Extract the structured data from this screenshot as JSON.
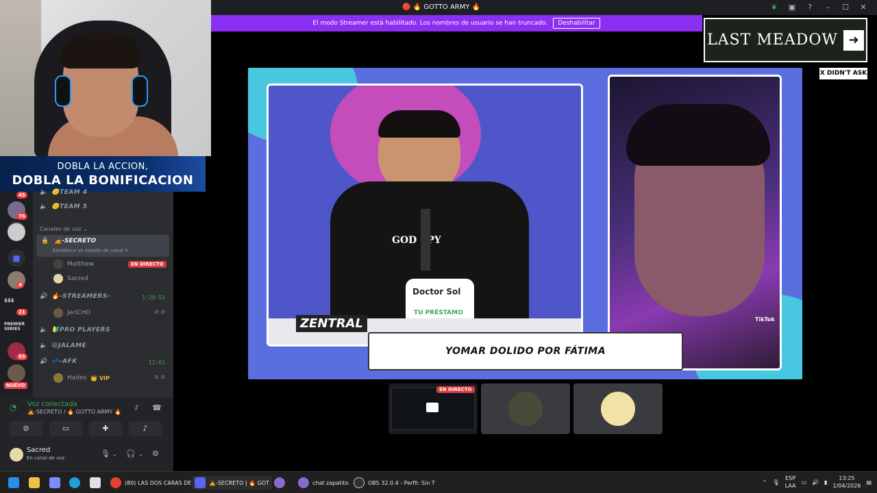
{
  "window": {
    "title": "🔴 🔥 GOTTO ARMY 🔥"
  },
  "streamer_bar": {
    "message": "El modo Streamer está habilitado. Los nombres de usuario se han truncado.",
    "button": "Deshabilitar"
  },
  "promo": {
    "line1": "DOBLA LA ACCION,",
    "line2": "DOBLA LA BONIFICACION"
  },
  "rail": {
    "badges": [
      "45",
      "76",
      "4",
      "21",
      "85"
    ],
    "text_sss": "$$$",
    "premier": "PREMIER SERIES",
    "nuevo": "NUEVO"
  },
  "channels": {
    "team4": "🙂TEAM 4",
    "team5": "🙂TEAM 5",
    "category": "Canales de voz ⌄",
    "secreto": {
      "name": "🙇-SECRETO",
      "status": "Establece un estado de canal ✎"
    },
    "users_secreto": [
      {
        "name": "Matthew",
        "live": "EN DIRECTO"
      },
      {
        "name": "Sacred"
      }
    ],
    "streamers": {
      "name": "🔥-STREAMERS-",
      "time": "1:28:53"
    },
    "streamer_users": [
      {
        "name": "JeriCHO"
      }
    ],
    "pro_players": "🔰PRO PLAYERS",
    "jalame": "😄JALAME",
    "afk": {
      "name": "💤-AFK",
      "time": "12:01"
    },
    "afk_users": [
      {
        "name": "Hades",
        "tag": "👑 VIP"
      }
    ]
  },
  "voice": {
    "connected": "Voz conectada",
    "channel": "🙇-SECRETO / 🔥 GOTTO ARMY 🔥",
    "user": "Sacred",
    "user_status": "En canal de voz"
  },
  "stage": {
    "lower_third": "YOMAR DOLIDO POR FÁTIMA",
    "brand_left": "ZENTRAL",
    "sponsor": "Doctor Sol",
    "sponsor_sub": "TU PRÉSTAMO",
    "shirt": "GOD SPY",
    "tiktok": "TikTok"
  },
  "banner": {
    "title": "LAST MEADOW",
    "arrow": "➜"
  },
  "tag_xda": "X DIDN'T ASK",
  "tiles": [
    {
      "live": "EN DIRECTO"
    },
    {},
    {}
  ],
  "taskbar": {
    "apps": [
      "(80) LAS DOS CARAS DE",
      "🙇-SECRETO | 🔥 GOT",
      "chat zapatito",
      "OBS 32.0.4 - Perfil: Sin T"
    ],
    "lang": "ESP",
    "lang2": "LAA",
    "time": "13:25",
    "date": "1/04/2026"
  },
  "colors": {
    "discord_bg": "#2b2d31",
    "streamer": "#8b2ff2",
    "live_red": "#da373c",
    "voice_green": "#3ba55c"
  }
}
